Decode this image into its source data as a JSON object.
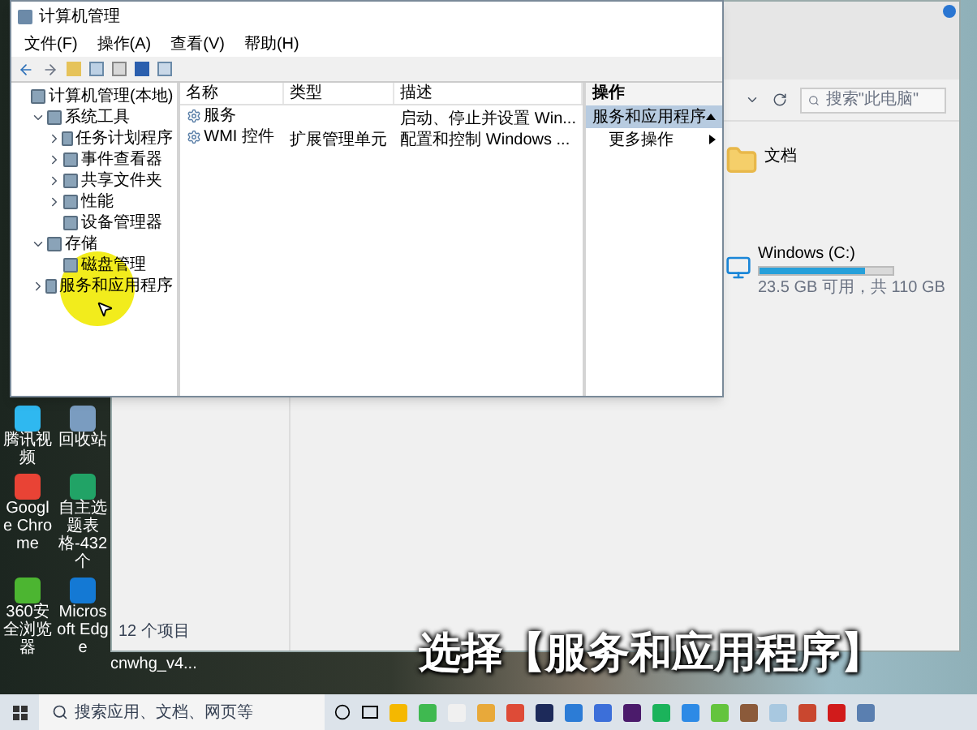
{
  "mmc": {
    "title": "计算机管理",
    "menu": [
      "文件(F)",
      "操作(A)",
      "查看(V)",
      "帮助(H)"
    ],
    "tree": [
      {
        "label": "计算机管理(本地)",
        "children": [
          {
            "label": "系统工具",
            "expanded": true,
            "children": [
              {
                "label": "任务计划程序",
                "expanded": false
              },
              {
                "label": "事件查看器",
                "expanded": false
              },
              {
                "label": "共享文件夹",
                "expanded": false
              },
              {
                "label": "性能",
                "expanded": false
              },
              {
                "label": "设备管理器"
              }
            ]
          },
          {
            "label": "存储",
            "expanded": true,
            "children": [
              {
                "label": "磁盘管理"
              }
            ]
          },
          {
            "label": "服务和应用程序",
            "expanded": false
          }
        ]
      }
    ],
    "columns": [
      "名称",
      "类型",
      "描述"
    ],
    "rows": [
      {
        "name": "服务",
        "description": "启动、停止并设置 Win..."
      },
      {
        "name": "WMI 控件",
        "type": "扩展管理单元",
        "description": "配置和控制 Windows ..."
      }
    ],
    "actions": {
      "title": "操作",
      "section": "服务和应用程序",
      "items": [
        "更多操作"
      ]
    }
  },
  "explorer": {
    "search": {
      "placeholder": "搜索\"此电脑\""
    },
    "folders": [
      "文档"
    ],
    "drives": [
      {
        "name": "Windows (C:)",
        "level": 0.79,
        "info": "23.5 GB 可用，共 110 GB"
      }
    ],
    "status": "12 个项目"
  },
  "desktop_icons": [
    "腾讯视频",
    "回收站",
    "Google Chrome",
    "自主选题表格-432个",
    "360安全浏览器",
    "Microsoft Edge",
    "cnwhg_v4..."
  ],
  "subtitle": "选择【服务和应用程序】",
  "taskbar": {
    "search": {
      "placeholder": "搜索应用、文档、网页等"
    }
  }
}
